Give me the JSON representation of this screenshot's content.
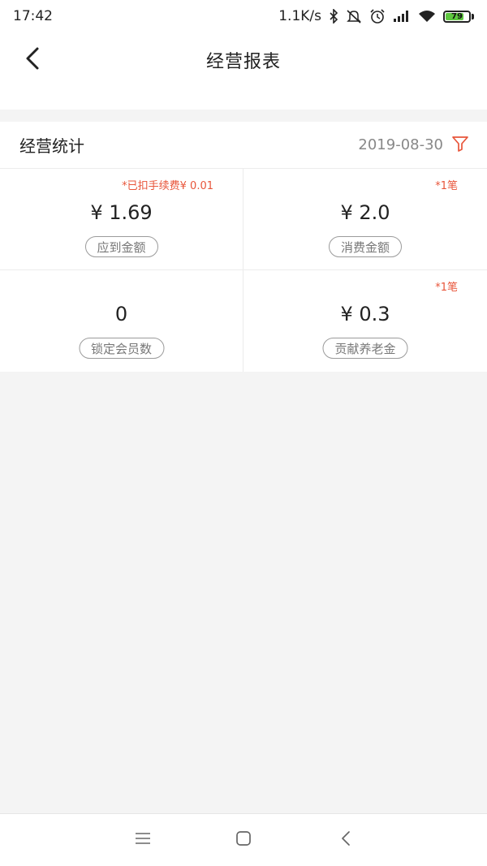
{
  "status_bar": {
    "time": "17:42",
    "network_speed": "1.1K/s",
    "battery_level": "79",
    "battery_fraction": 0.79,
    "icons": [
      "bluetooth-icon",
      "mute-icon",
      "alarm-icon",
      "signal-icon",
      "wifi-icon",
      "battery-icon"
    ]
  },
  "nav": {
    "title": "经营报表",
    "back_icon": "chevron-left-icon"
  },
  "stats": {
    "title": "经营统计",
    "date": "2019-08-30",
    "filter_icon": "filter-icon",
    "accent_color": "#e8553a",
    "cells": [
      {
        "note": "*已扣手续费¥ 0.01",
        "value": "¥ 1.69",
        "label": "应到金额"
      },
      {
        "note": "*1笔",
        "value": "¥ 2.0",
        "label": "消费金额"
      },
      {
        "note": "",
        "value": "0",
        "label": "锁定会员数"
      },
      {
        "note": "*1笔",
        "value": "¥ 0.3",
        "label": "贡献养老金"
      }
    ]
  },
  "system_nav": {
    "icons": [
      "menu-icon",
      "home-icon",
      "back-icon"
    ]
  }
}
